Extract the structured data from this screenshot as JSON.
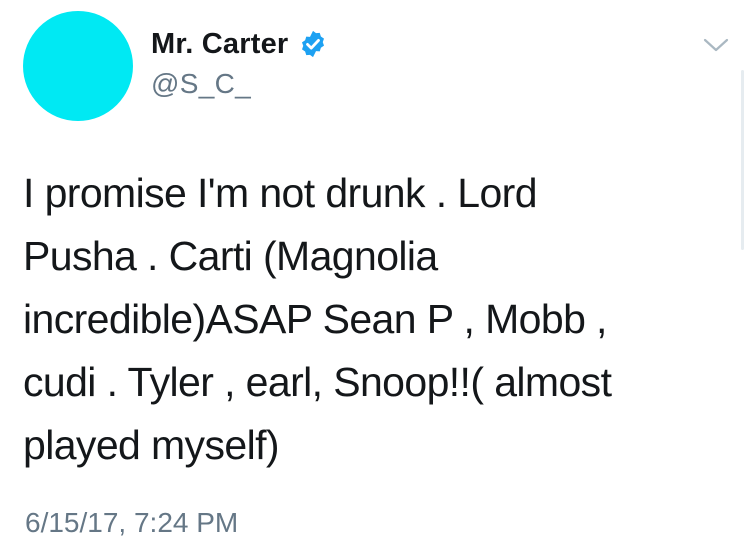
{
  "tweet": {
    "display_name": "Mr. Carter",
    "handle": "@S_C_",
    "verified": true,
    "text": "I promise I'm not drunk . Lord\nPusha . Carti (Magnolia\nincredible)ASAP Sean P , Mobb ,\ncudi . Tyler , earl, Snoop!!( almost\nplayed myself)",
    "timestamp": "6/15/17, 7:24 PM"
  },
  "colors": {
    "avatar": "#00e9f3",
    "verified_badge": "#1da1f2",
    "secondary_text": "#657786",
    "primary_text": "#14171a"
  },
  "icons": {
    "verified": "verified-badge-icon",
    "menu": "chevron-down-icon"
  }
}
